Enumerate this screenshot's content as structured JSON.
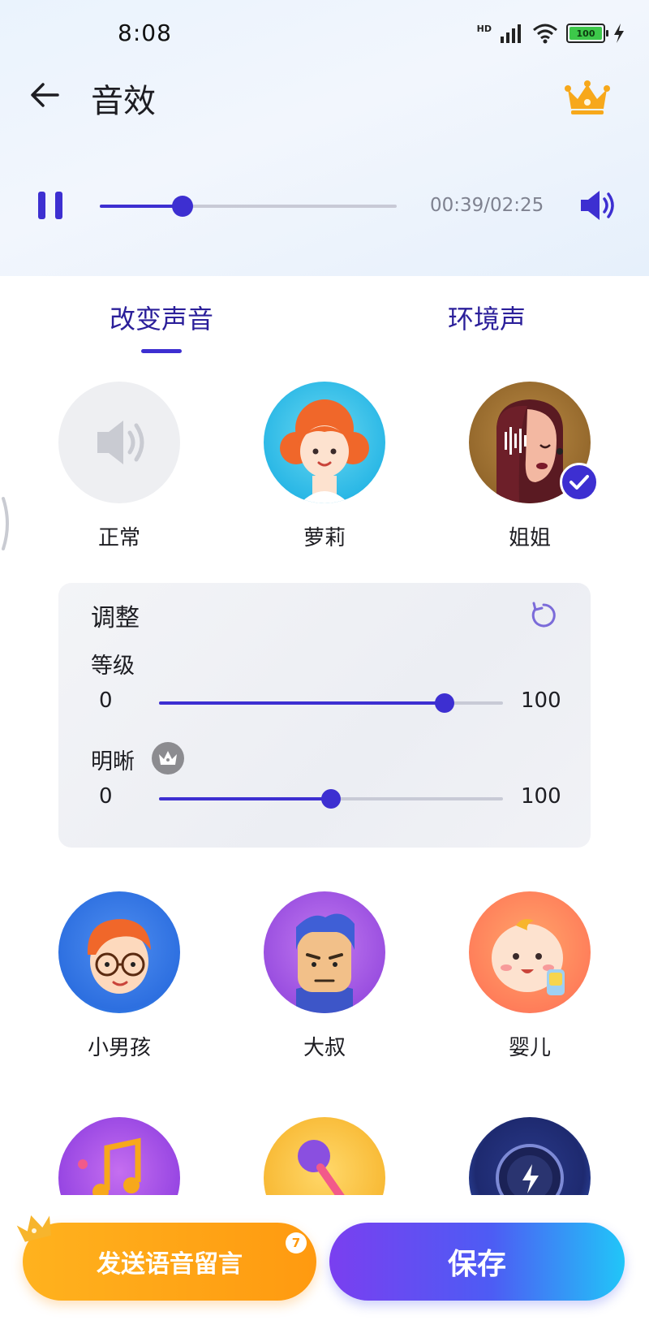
{
  "status_bar": {
    "time": "8:08",
    "network": "HD",
    "battery": "100"
  },
  "header": {
    "title": "音效"
  },
  "player": {
    "state": "playing",
    "progress": 0.28,
    "time_readout": "00:39/02:25"
  },
  "tabs": [
    {
      "label": "改变声音",
      "selected": true
    },
    {
      "label": "环境声",
      "selected": false
    }
  ],
  "voices": [
    {
      "label": "正常"
    },
    {
      "label": "萝莉"
    },
    {
      "label": "姐姐",
      "selected": true
    },
    {
      "label": "小男孩"
    },
    {
      "label": "大叔"
    },
    {
      "label": "婴儿"
    }
  ],
  "adjust": {
    "title": "调整",
    "sliders": [
      {
        "label": "等级",
        "min": "0",
        "max": "100",
        "value": 83
      },
      {
        "label": "明晰",
        "min": "0",
        "max": "100",
        "value": 50,
        "premium": true
      }
    ]
  },
  "actions": {
    "send_label": "发送语音留言",
    "send_badge": "7",
    "save_label": "保存"
  },
  "colors": {
    "accent": "#3d2fd1",
    "tab_text": "#2b1f9a",
    "send": "#ffa316",
    "premium": "#f7a81b"
  }
}
